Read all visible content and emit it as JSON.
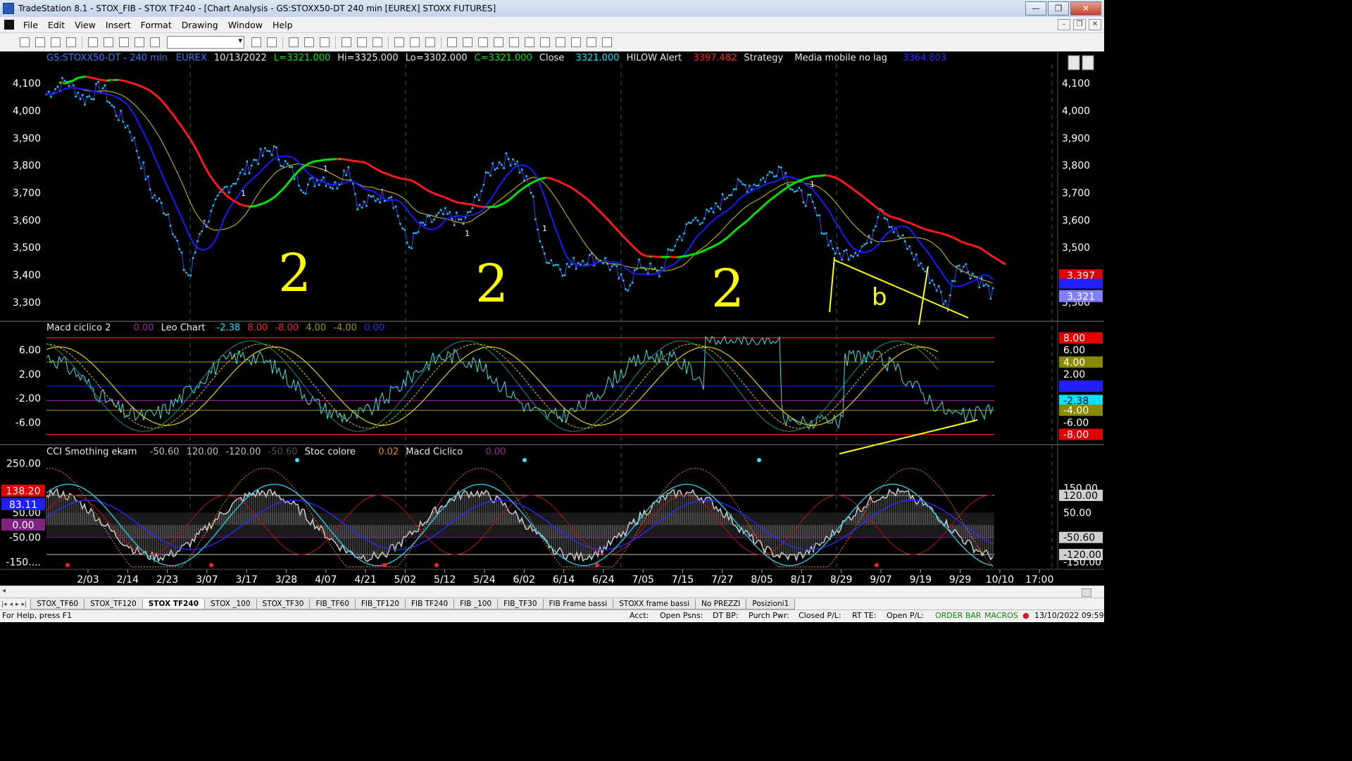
{
  "window": {
    "title": "TradeStation 8.1 - STOX_FIB - STOX TF240 - [Chart Analysis - GS:STOXX50-DT  240 min  [EUREX] STOXX FUTURES]",
    "buttons": {
      "minimize": "—",
      "maximize": "❐",
      "close": "✕"
    }
  },
  "menu": [
    "File",
    "Edit",
    "View",
    "Insert",
    "Format",
    "Drawing",
    "Window",
    "Help"
  ],
  "header": {
    "symbol": "GS:STOXX50-DT - 240 min",
    "exchange": "EUREX",
    "date": "10/13/2022",
    "last": "L=3321.000",
    "high": "Hi=3325.000",
    "low": "Lo=3302.000",
    "close_val": "C=3321.000",
    "close_label": "Close",
    "close_num": "3321.000",
    "hilow": "HILOW Alert",
    "hilow_val": "3397.482",
    "strategy": "Strategy",
    "media": "Media mobile no lag",
    "media_val": "3364.803"
  },
  "panel2_header": {
    "name": "Macd ciclico 2",
    "v1": "0.00",
    "leo": "Leo Chart",
    "v2": "-2.38",
    "v3": "8.00",
    "v4": "-8.00",
    "v5": "4.00",
    "v6": "-4.00",
    "v7": "0.00"
  },
  "panel3_header": {
    "name": "CCI Smothing ekam",
    "v1": "-50.60",
    "v2": "120.00",
    "v3": "-120.00",
    "v4": "-50.60",
    "stoc": "Stoc colore",
    "v5": "0.02",
    "macd": "Macd Ciclico",
    "v6": "0.00"
  },
  "price_axis": [
    "4,100",
    "4,000",
    "3,900",
    "3,800",
    "3,700",
    "3,600",
    "3,500",
    "3,400",
    "3,300"
  ],
  "price_tags": {
    "red": "3,397",
    "blue": "3,365",
    "last": "3,321"
  },
  "macd_axis": [
    "6.00",
    "2.00",
    "-2.00",
    "-6.00"
  ],
  "macd_tags": {
    "t8": "8.00",
    "t6": "6.00",
    "t4": "4.00",
    "t2": "2.00",
    "t0": "0.00",
    "tm238": "-2.38",
    "tm4": "-4.00",
    "tm6": "-6.00",
    "tm8": "-8.00"
  },
  "cci_axis_left": [
    "250.00",
    "50.00",
    "-50.00",
    "-150...."
  ],
  "cci_left_tags": {
    "a": "138.20",
    "b": "83.11",
    "c": "0.00"
  },
  "cci_tags": {
    "t150": "150.00",
    "t120": "120.00",
    "t50": "50.00",
    "tm50": "-50.60",
    "tm120": "-120.00",
    "tm150": "-150.00"
  },
  "x_axis": [
    "2/03",
    "2/14",
    "2/23",
    "3/07",
    "3/17",
    "3/28",
    "4/07",
    "4/21",
    "5/02",
    "5/12",
    "5/24",
    "6/02",
    "6/14",
    "6/24",
    "7/05",
    "7/15",
    "7/27",
    "8/05",
    "8/17",
    "8/29",
    "9/07",
    "9/19",
    "9/29",
    "10/10",
    "17:00"
  ],
  "annotations": [
    "2",
    "2",
    "2",
    "1",
    "b"
  ],
  "bar_markers": [
    "1",
    "-1",
    "1",
    "1",
    "1"
  ],
  "tabs": [
    "STOX_TF60",
    "STOX_TF120",
    "STOX TF240",
    "STOX _100",
    "STOX_TF30",
    "FIB_TF60",
    "FIB_TF120",
    "FIB TF240",
    "FIB _100",
    "FIB_TF30",
    "FIB Frame bassi",
    "STOXX frame bassi",
    "No PREZZI",
    "Posizioni1"
  ],
  "active_tab": "STOX TF240",
  "status": {
    "help": "For Help, press F1",
    "acct": "Acct:",
    "open_psns": "Open Psns:",
    "dt_bp": "DT BP:",
    "purch_pwr": "Purch Pwr:",
    "closed_pl": "Closed P/L:",
    "rt_te": "RT TE:",
    "open_pl": "Open P/L:",
    "order_bar": "ORDER BAR",
    "macros": "MACROS",
    "datetime": "13/10/2022 09:59"
  },
  "colors": {
    "price": "#00e5ff",
    "ma_red": "#ff1a1a",
    "ma_blue": "#1a1aff",
    "ma_yellow": "#d6c200",
    "ma_green": "#00e600",
    "annot": "#ffff00"
  }
}
